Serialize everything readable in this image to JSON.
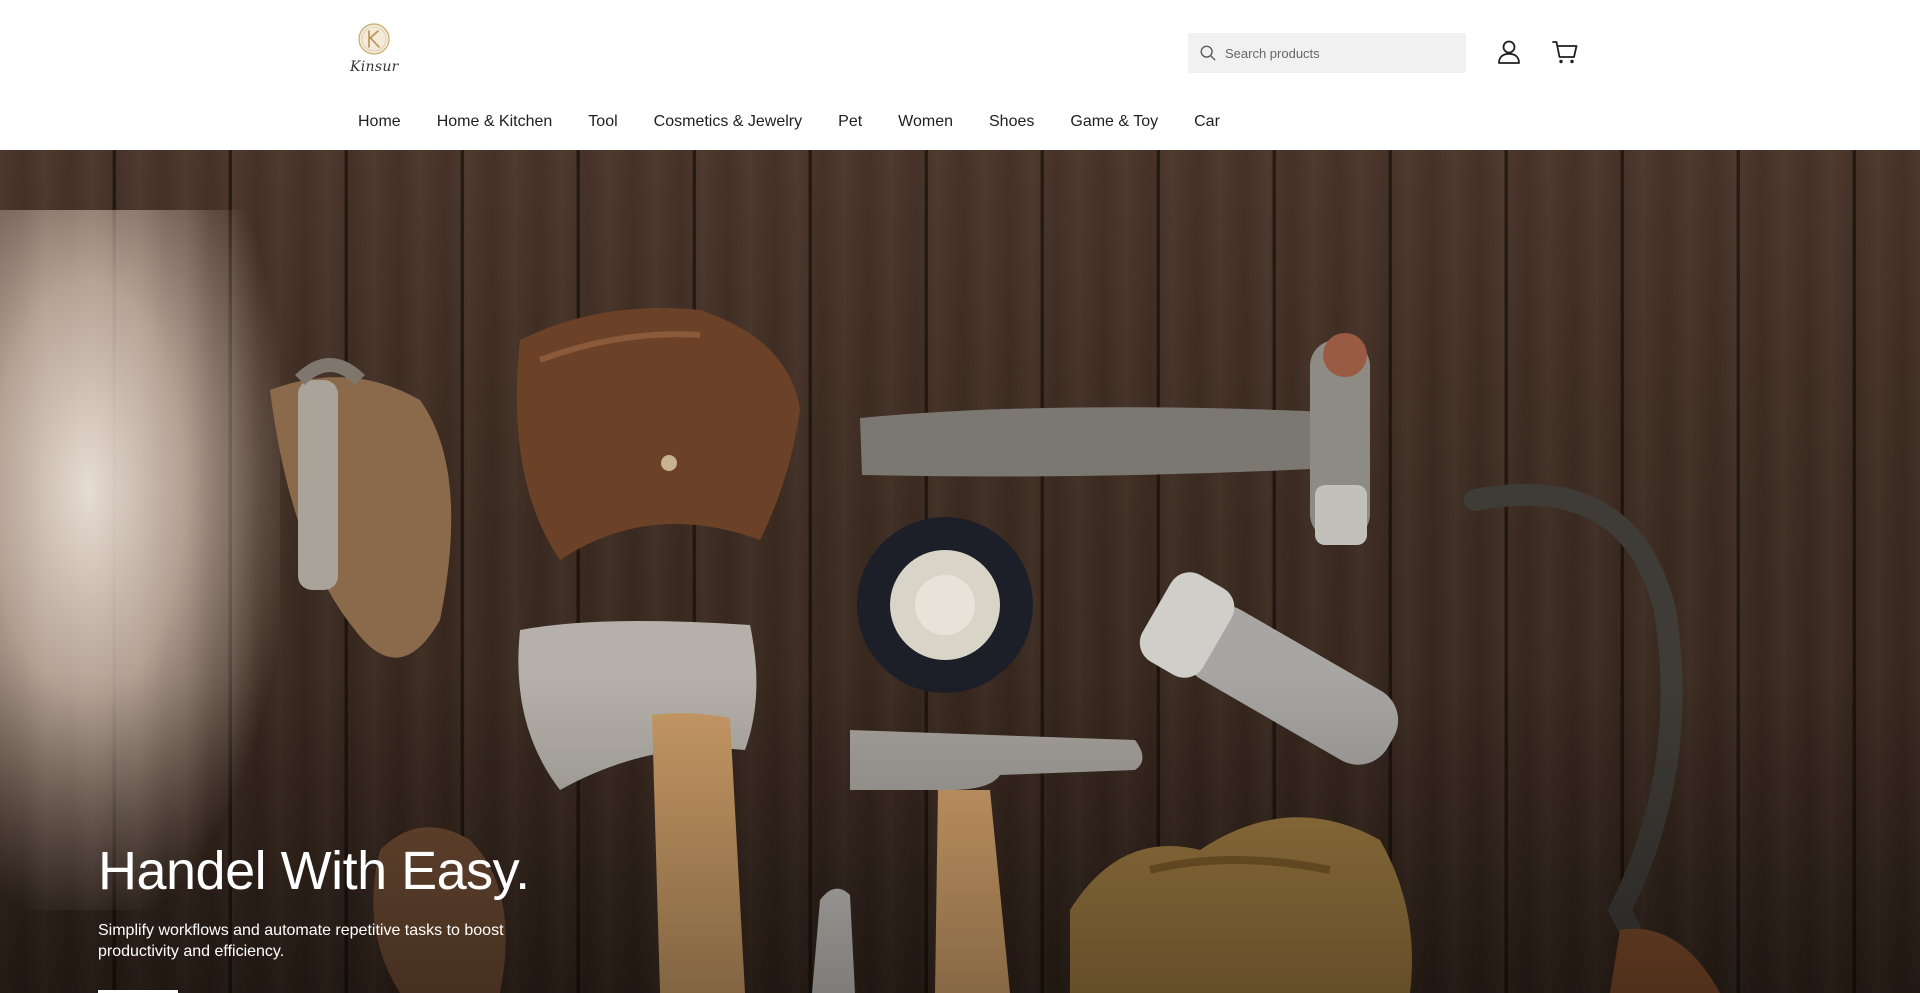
{
  "brand": {
    "name": "Kinsur",
    "accent": "#c9a86a"
  },
  "search": {
    "placeholder": "Search products"
  },
  "icons": {
    "search": "search-icon",
    "account": "user-icon",
    "cart": "cart-icon"
  },
  "nav": {
    "items": [
      {
        "label": "Home"
      },
      {
        "label": "Home & Kitchen"
      },
      {
        "label": "Tool"
      },
      {
        "label": "Cosmetics & Jewelry"
      },
      {
        "label": "Pet"
      },
      {
        "label": "Women"
      },
      {
        "label": "Shoes"
      },
      {
        "label": "Game & Toy"
      },
      {
        "label": "Car"
      }
    ]
  },
  "hero": {
    "title": "Handel With Easy.",
    "subtitle": "Simplify workflows and automate repetitive tasks to boost productivity and efficiency.",
    "button_label": ""
  }
}
